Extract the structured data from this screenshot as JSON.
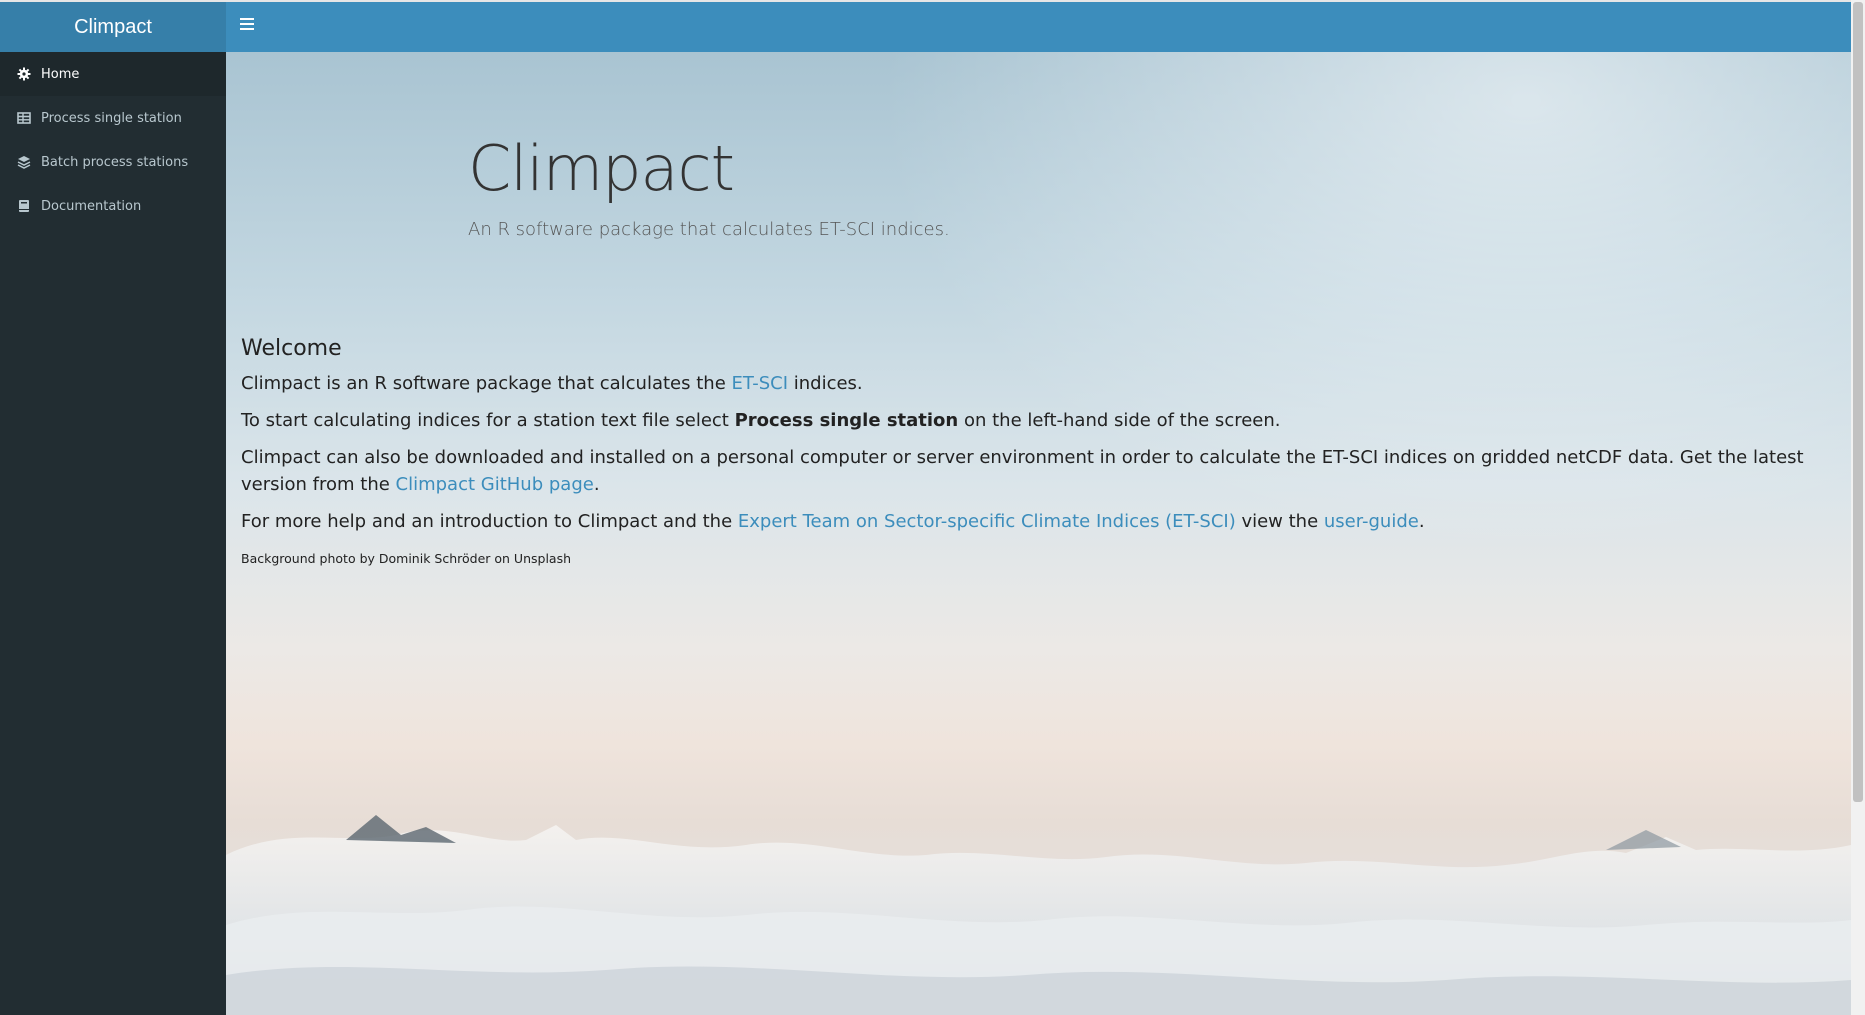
{
  "header": {
    "brand": "Climpact",
    "toggle_icon": "hamburger-icon"
  },
  "sidebar": {
    "items": [
      {
        "label": "Home",
        "icon": "gear-icon",
        "active": true
      },
      {
        "label": "Process single station",
        "icon": "table-icon",
        "active": false
      },
      {
        "label": "Batch process stations",
        "icon": "layers-icon",
        "active": false
      },
      {
        "label": "Documentation",
        "icon": "book-icon",
        "active": false
      }
    ]
  },
  "jumbotron": {
    "title": "Climpact",
    "subtitle": "An R software package that calculates ET-SCI indices."
  },
  "content": {
    "welcome_heading": "Welcome",
    "p1_pre": "Climpact is an R software package that calculates the ",
    "p1_link": "ET-SCI",
    "p1_post": " indices.",
    "p2_pre": "To start calculating indices for a station text file select ",
    "p2_bold": "Process single station",
    "p2_post": " on the left-hand side of the screen.",
    "p3_pre": "Climpact can also be downloaded and installed on a personal computer or server environment in order to calculate the ET-SCI indices on gridded netCDF data. Get the latest version from the ",
    "p3_link": "Climpact GitHub page",
    "p3_post": ".",
    "p4_pre": "For more help and an introduction to Climpact and the ",
    "p4_link1": "Expert Team on Sector-specific Climate Indices (ET-SCI)",
    "p4_mid": " view the ",
    "p4_link2": "user-guide",
    "p4_post": ".",
    "credit": "Background photo by Dominik Schröder on Unsplash"
  },
  "colors": {
    "header": "#3c8dbc",
    "brand_bg": "#367fa9",
    "sidebar": "#222d32",
    "sidebar_active": "#1e282c",
    "link": "#3c8dbc"
  }
}
